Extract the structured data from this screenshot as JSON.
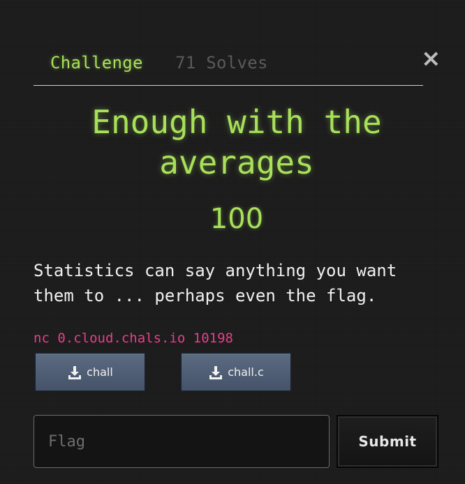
{
  "tabs": {
    "challenge_label": "Challenge",
    "solves_label": "71 Solves"
  },
  "close_label": "×",
  "challenge": {
    "title": "Enough with the averages",
    "points": "100",
    "description": "Statistics can say anything you want them to ... perhaps even the flag.",
    "connection": "nc 0.cloud.chals.io 10198"
  },
  "files": [
    {
      "label": "chall",
      "icon": "download-icon"
    },
    {
      "label": "chall.c",
      "icon": "download-icon"
    }
  ],
  "flag_form": {
    "placeholder": "Flag",
    "value": "",
    "submit_label": "Submit"
  },
  "colors": {
    "accent": "#a8e05a",
    "connection": "#e83e8c",
    "file_button": "#4f5e74",
    "background": "#1c1c1c"
  }
}
